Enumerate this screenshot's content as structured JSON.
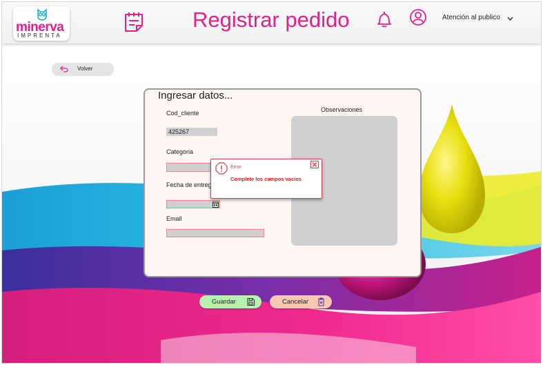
{
  "header": {
    "logo_word": "minerva",
    "logo_sub": "IMPRENTA",
    "title": "Registrar pedido",
    "user_label": "Atención al publico"
  },
  "back": {
    "label": "Volver"
  },
  "form": {
    "title": "Ingresar datos...",
    "cod_cliente_label": "Cod_cliente",
    "cod_cliente_value": "425267",
    "categoria_label": "Categoria",
    "fecha_label": "Fecha de entrega",
    "email_label": "Email",
    "observaciones_label": "Observaciones"
  },
  "error": {
    "title": "Error",
    "message": "Complete los campos vacios"
  },
  "actions": {
    "save_label": "Guardar",
    "cancel_label": "Cancelar"
  },
  "colors": {
    "brand": "#e0218a",
    "save": "#b8f2b0",
    "cancel": "#f7c9b4",
    "error": "#d41a1a"
  },
  "icons": [
    "owl-logo-icon",
    "notes-icon",
    "bell-icon",
    "user-icon",
    "chevron-down-icon",
    "back-arrow-icon",
    "warning-icon",
    "close-icon",
    "calendar-icon",
    "save-icon",
    "cancel-icon"
  ]
}
